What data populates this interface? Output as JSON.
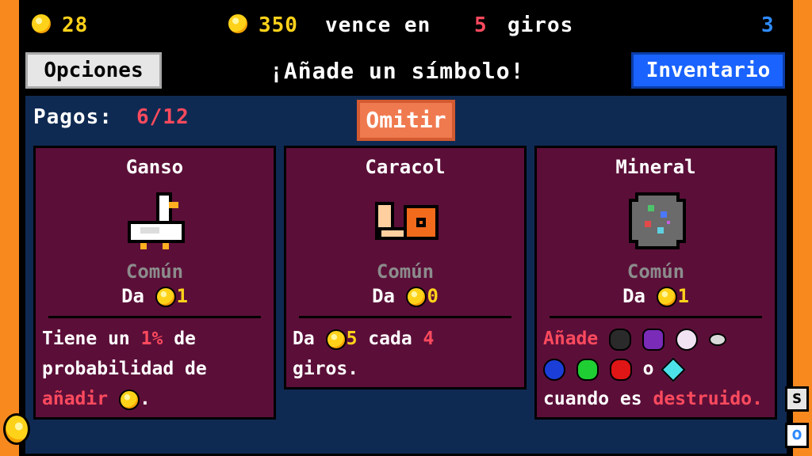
{
  "hud": {
    "coins": "28",
    "rent_amount": "350",
    "rent_text": "vence en",
    "spins_left": "5",
    "spins_word": "giros",
    "counter": "3"
  },
  "menu": {
    "options_label": "Opciones",
    "prompt": "¡Añade un símbolo!",
    "inventory_label": "Inventario"
  },
  "payments": {
    "label": "Pagos:",
    "value": "6/12"
  },
  "skip_label": "Omitir",
  "cards": [
    {
      "name": "Ganso",
      "rarity": "Común",
      "pays_word": "Da",
      "pays_value": "1",
      "desc": {
        "p1": "Tiene un",
        "pct": "1%",
        "p2": "de probabilidad de",
        "verb": "añadir",
        "end": "."
      }
    },
    {
      "name": "Caracol",
      "rarity": "Común",
      "pays_word": "Da",
      "pays_value": "0",
      "desc": {
        "p1": "Da",
        "amount": "5",
        "p2": "cada",
        "every": "4",
        "p3": "giros."
      }
    },
    {
      "name": "Mineral",
      "rarity": "Común",
      "pays_word": "Da",
      "pays_value": "1",
      "desc": {
        "verb": "Añade",
        "or": "o",
        "p2": "cuando es",
        "cond": "destruido."
      }
    }
  ],
  "side": {
    "top_button": "s",
    "bottom_button": "o"
  },
  "colors": {
    "background_orange": "#f7891f",
    "board_navy": "#0f2a52",
    "card_maroon": "#5b0f38",
    "coin_yellow": "#ffd21a",
    "highlight_red": "#ff4a5e",
    "inventory_blue": "#1a63ff",
    "skip_orange": "#f07a4f"
  },
  "icons": [
    "coin-icon",
    "goose-icon",
    "snail-icon",
    "ore-icon",
    "coal-icon",
    "amethyst-icon",
    "pearl-icon",
    "stone-icon",
    "sapphire-icon",
    "emerald-icon",
    "ruby-icon",
    "diamond-icon"
  ]
}
